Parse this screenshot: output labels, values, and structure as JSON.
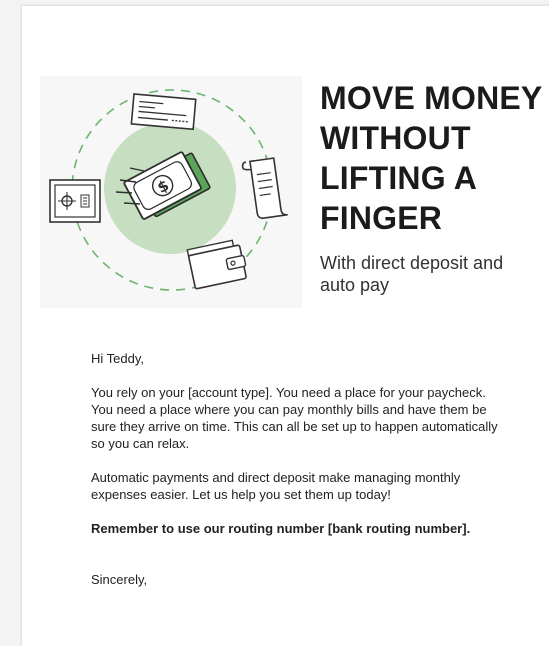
{
  "hero": {
    "headline": "MOVE MONEY WITHOUT LIFTING A FINGER",
    "subheadline": "With direct deposit and auto pay",
    "illustration_icons": [
      "check-icon",
      "money-bill-icon",
      "receipt-icon",
      "safe-icon",
      "wallet-icon"
    ],
    "accent_color": "#c5dfc0",
    "accent_dark": "#5aa55a"
  },
  "letter": {
    "greeting": "Hi Teddy,",
    "paragraph1": "You rely on your [account type]. You need a place for your paycheck. You need a place where you can pay monthly bills and have them be sure they arrive on time. This can all be set up to happen automatically so you can relax.",
    "paragraph2": "Automatic payments and direct deposit make managing monthly expenses easier. Let us help you set them up today!",
    "routing_note": "Remember to use our routing number [bank routing number].",
    "closing": "Sincerely,"
  }
}
